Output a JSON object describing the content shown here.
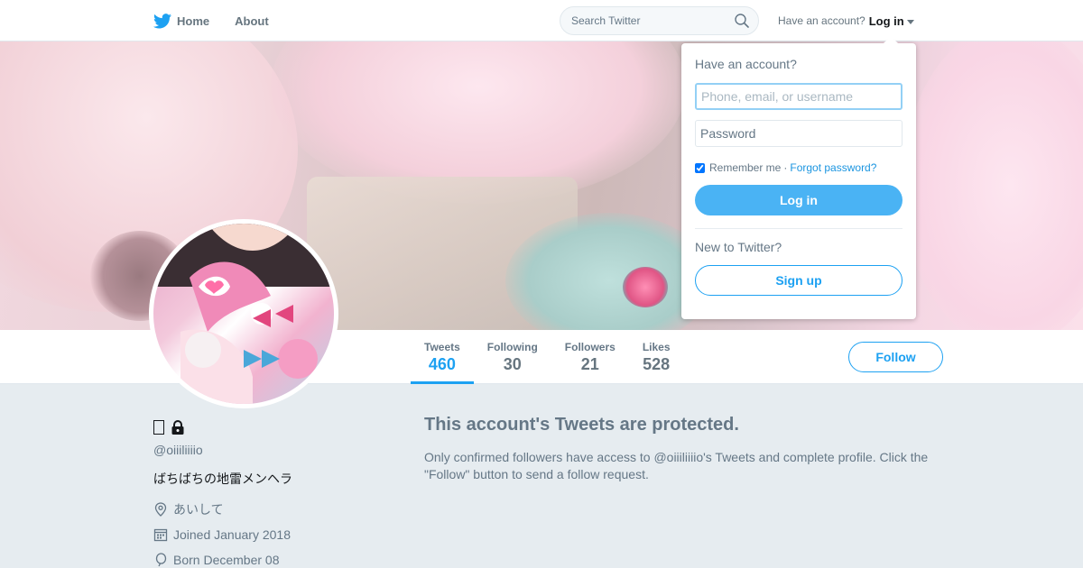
{
  "nav": {
    "home_label": "Home",
    "about_label": "About",
    "search_placeholder": "Search Twitter",
    "have_account": "Have an account?",
    "login_label": "Log in"
  },
  "profile": {
    "handle": "@oiiiliiiio",
    "bio": "ばちばちの地雷メンヘラ",
    "location": "あいして",
    "joined": "Joined January 2018",
    "born": "Born December 08"
  },
  "stats": [
    {
      "label": "Tweets",
      "value": "460"
    },
    {
      "label": "Following",
      "value": "30"
    },
    {
      "label": "Followers",
      "value": "21"
    },
    {
      "label": "Likes",
      "value": "528"
    }
  ],
  "follow_label": "Follow",
  "protected": {
    "title": "This account's Tweets are protected.",
    "message": "Only confirmed followers have access to @oiiiliiiio's Tweets and complete profile. Click the \"Follow\" button to send a follow request."
  },
  "login_dropdown": {
    "title": "Have an account?",
    "username_placeholder": "Phone, email, or username",
    "password_placeholder": "Password",
    "remember_label": "Remember me",
    "separator": "·",
    "forgot_label": "Forgot password?",
    "login_button": "Log in",
    "new_to": "New to Twitter?",
    "signup_button": "Sign up"
  },
  "colors": {
    "accent": "#1da1f2",
    "page_bg": "#e6ecf0",
    "muted_text": "#657786"
  },
  "icons": [
    "twitter-bird-icon",
    "search-icon",
    "lock-icon",
    "location-icon",
    "calendar-icon",
    "balloon-icon",
    "caret-down-icon"
  ]
}
